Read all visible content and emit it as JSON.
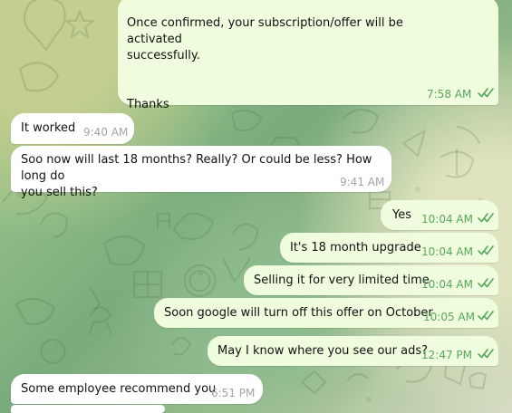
{
  "messages": [
    {
      "direction": "outgoing",
      "text": " Once confirmed, your subscription/offer will be activated\nsuccessfully.\n\n\nThanks",
      "time": "7:58 AM",
      "status_icon": "double-check-icon"
    },
    {
      "direction": "incoming",
      "text": "It worked",
      "time": "9:40 AM"
    },
    {
      "direction": "incoming",
      "text": "Soo now will last 18 months? Really? Or could be less? How long do\nyou sell this?",
      "time": "9:41 AM"
    },
    {
      "direction": "outgoing",
      "text": "Yes",
      "time": "10:04 AM",
      "status_icon": "double-check-icon"
    },
    {
      "direction": "outgoing",
      "text": "It's 18 month upgrade",
      "time": "10:04 AM",
      "status_icon": "double-check-icon"
    },
    {
      "direction": "outgoing",
      "text": "Selling it for very limited time",
      "time": "10:04 AM",
      "status_icon": "double-check-icon"
    },
    {
      "direction": "outgoing",
      "text": "Soon google will turn off this offer on October",
      "time": "10:05 AM",
      "status_icon": "double-check-icon"
    },
    {
      "direction": "outgoing",
      "text": "May I know where you see our ads?",
      "time": "12:47 PM",
      "status_icon": "double-check-icon"
    },
    {
      "direction": "incoming",
      "text": "Some employee recommend you",
      "time": "6:51 PM"
    }
  ],
  "colors": {
    "incoming_bubble": "#ffffff",
    "outgoing_bubble": "#effdde",
    "incoming_time": "#9ca6ac",
    "outgoing_time": "#58a65b",
    "check_color": "#58a65b"
  }
}
